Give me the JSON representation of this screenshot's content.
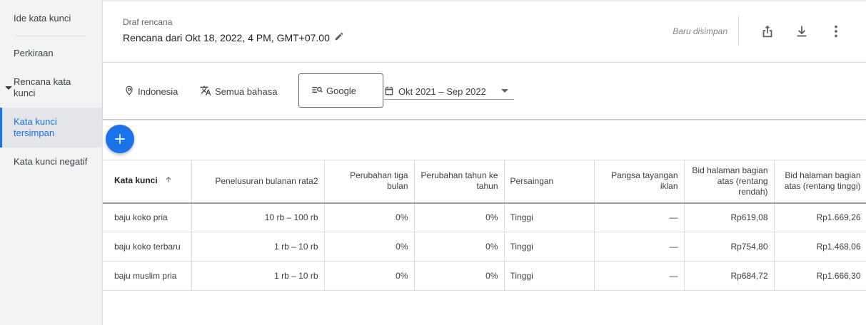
{
  "sidebar": {
    "items": [
      {
        "label": "Ide kata kunci"
      },
      {
        "label": "Perkiraan"
      },
      {
        "label": "Rencana kata kunci"
      },
      {
        "label": "Kata kunci tersimpan"
      },
      {
        "label": "Kata kunci negatif"
      }
    ]
  },
  "header": {
    "draft_label": "Draf rencana",
    "plan_title": "Rencana dari Okt 18, 2022, 4 PM, GMT+07.00",
    "saved_status": "Baru disimpan",
    "icons": [
      "share-icon",
      "download-icon",
      "more-vert-icon",
      "edit-icon"
    ]
  },
  "filters": {
    "location": "Indonesia",
    "language": "Semua bahasa",
    "network": "Google",
    "date_range": "Okt 2021 – Sep 2022",
    "icons": [
      "location-pin-icon",
      "translate-icon",
      "search-network-icon",
      "calendar-icon"
    ]
  },
  "table": {
    "headers": {
      "keyword": "Kata kunci",
      "avg_searches": "Penelusuran bulanan rata2",
      "three_month": "Perubahan tiga bulan",
      "yoy": "Perubahan tahun ke tahun",
      "competition": "Persaingan",
      "impression_share": "Pangsa tayangan iklan",
      "bid_low": "Bid halaman bagian atas (rentang rendah)",
      "bid_high": "Bid halaman bagian atas (rentang tinggi)"
    },
    "rows": [
      {
        "keyword": "baju koko pria",
        "avg_searches": "10 rb – 100 rb",
        "three_month": "0%",
        "yoy": "0%",
        "competition": "Tinggi",
        "impression_share": "—",
        "bid_low": "Rp619,08",
        "bid_high": "Rp1.669,26"
      },
      {
        "keyword": "baju koko terbaru",
        "avg_searches": "1 rb – 10 rb",
        "three_month": "0%",
        "yoy": "0%",
        "competition": "Tinggi",
        "impression_share": "—",
        "bid_low": "Rp754,80",
        "bid_high": "Rp1.468,06"
      },
      {
        "keyword": "baju muslim pria",
        "avg_searches": "1 rb – 10 rb",
        "three_month": "0%",
        "yoy": "0%",
        "competition": "Tinggi",
        "impression_share": "—",
        "bid_low": "Rp684,72",
        "bid_high": "Rp1.666,30"
      }
    ]
  },
  "colors": {
    "accent": "#1a73e8",
    "sidebar_bg": "#f1f3f4",
    "text": "#3c4043"
  }
}
